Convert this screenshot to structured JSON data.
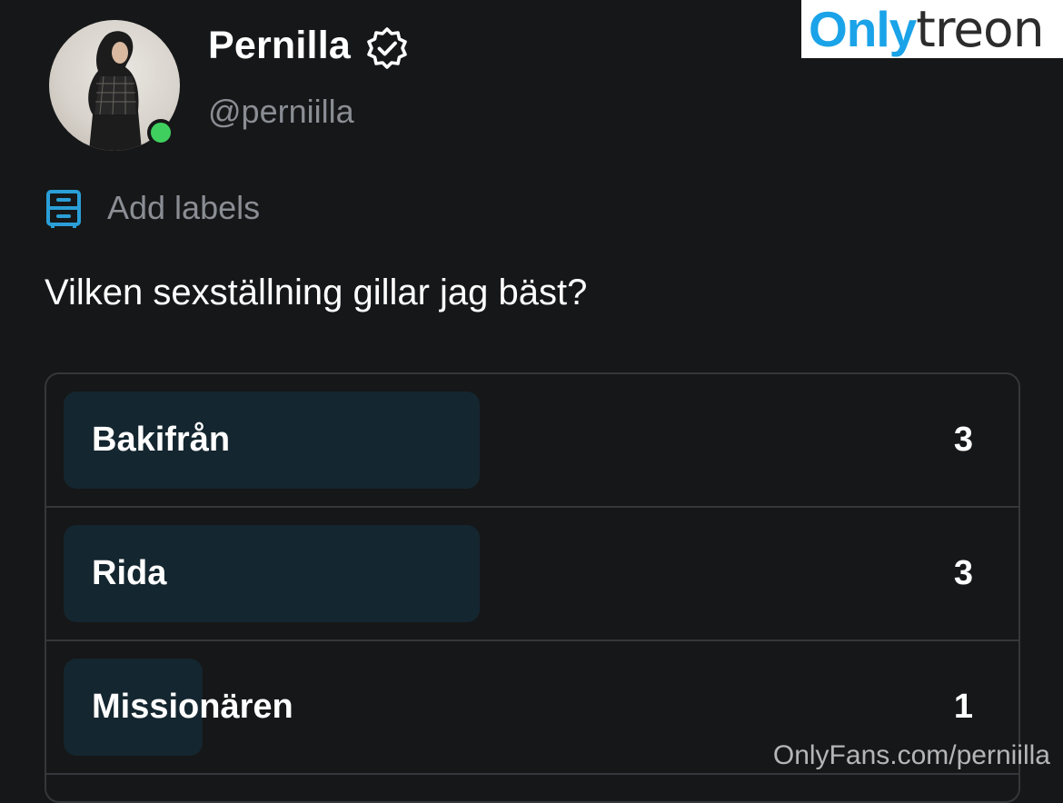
{
  "profile": {
    "display_name": "Pernilla",
    "handle": "@perniilla",
    "online_status_color": "#3fcf5e",
    "verified_icon": "verified-badge-icon"
  },
  "labels": {
    "icon": "label-drawer-icon",
    "text": "Add labels",
    "accent_color": "#2a9fd8"
  },
  "poll": {
    "question": "Vilken sexställning gillar jag bäst?",
    "options": [
      {
        "label": "Bakifrån",
        "count": "3",
        "share": 3
      },
      {
        "label": "Rida",
        "count": "3",
        "share": 3
      },
      {
        "label": "Missionären",
        "count": "1",
        "share": 1
      }
    ],
    "max_count": 3,
    "fill_color": "#14262f"
  },
  "watermarks": {
    "logo_part1": "Only",
    "logo_part2": "treon",
    "logo_part1_color": "#1aa3e8",
    "footer": "OnlyFans.com/perniilla"
  }
}
